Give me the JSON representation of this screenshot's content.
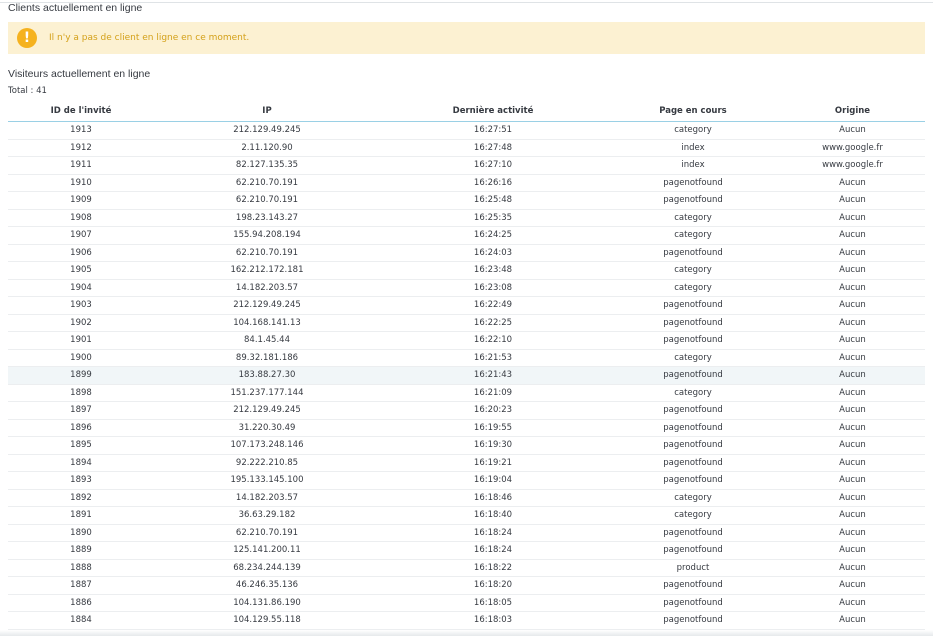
{
  "customers_section": {
    "title": "Clients actuellement en ligne",
    "alert_text": "Il n'y a pas de client en ligne en ce moment.",
    "alert_icon": "!"
  },
  "visitors_section": {
    "title": "Visiteurs actuellement en ligne",
    "total": "Total : 41",
    "columns": [
      "ID de l'invité",
      "IP",
      "Dernière activité",
      "Page en cours",
      "Origine"
    ],
    "highlighted_row_id": "1899",
    "rows": [
      [
        "1913",
        "212.129.49.245",
        "16:27:51",
        "category",
        "Aucun"
      ],
      [
        "1912",
        "2.11.120.90",
        "16:27:48",
        "index",
        "www.google.fr"
      ],
      [
        "1911",
        "82.127.135.35",
        "16:27:10",
        "index",
        "www.google.fr"
      ],
      [
        "1910",
        "62.210.70.191",
        "16:26:16",
        "pagenotfound",
        "Aucun"
      ],
      [
        "1909",
        "62.210.70.191",
        "16:25:48",
        "pagenotfound",
        "Aucun"
      ],
      [
        "1908",
        "198.23.143.27",
        "16:25:35",
        "category",
        "Aucun"
      ],
      [
        "1907",
        "155.94.208.194",
        "16:24:25",
        "category",
        "Aucun"
      ],
      [
        "1906",
        "62.210.70.191",
        "16:24:03",
        "pagenotfound",
        "Aucun"
      ],
      [
        "1905",
        "162.212.172.181",
        "16:23:48",
        "category",
        "Aucun"
      ],
      [
        "1904",
        "14.182.203.57",
        "16:23:08",
        "category",
        "Aucun"
      ],
      [
        "1903",
        "212.129.49.245",
        "16:22:49",
        "pagenotfound",
        "Aucun"
      ],
      [
        "1902",
        "104.168.141.13",
        "16:22:25",
        "pagenotfound",
        "Aucun"
      ],
      [
        "1901",
        "84.1.45.44",
        "16:22:10",
        "pagenotfound",
        "Aucun"
      ],
      [
        "1900",
        "89.32.181.186",
        "16:21:53",
        "category",
        "Aucun"
      ],
      [
        "1899",
        "183.88.27.30",
        "16:21:43",
        "pagenotfound",
        "Aucun"
      ],
      [
        "1898",
        "151.237.177.144",
        "16:21:09",
        "category",
        "Aucun"
      ],
      [
        "1897",
        "212.129.49.245",
        "16:20:23",
        "pagenotfound",
        "Aucun"
      ],
      [
        "1896",
        "31.220.30.49",
        "16:19:55",
        "pagenotfound",
        "Aucun"
      ],
      [
        "1895",
        "107.173.248.146",
        "16:19:30",
        "pagenotfound",
        "Aucun"
      ],
      [
        "1894",
        "92.222.210.85",
        "16:19:21",
        "pagenotfound",
        "Aucun"
      ],
      [
        "1893",
        "195.133.145.100",
        "16:19:04",
        "pagenotfound",
        "Aucun"
      ],
      [
        "1892",
        "14.182.203.57",
        "16:18:46",
        "category",
        "Aucun"
      ],
      [
        "1891",
        "36.63.29.182",
        "16:18:40",
        "category",
        "Aucun"
      ],
      [
        "1890",
        "62.210.70.191",
        "16:18:24",
        "pagenotfound",
        "Aucun"
      ],
      [
        "1889",
        "125.141.200.11",
        "16:18:24",
        "pagenotfound",
        "Aucun"
      ],
      [
        "1888",
        "68.234.244.139",
        "16:18:22",
        "product",
        "Aucun"
      ],
      [
        "1887",
        "46.246.35.136",
        "16:18:20",
        "pagenotfound",
        "Aucun"
      ],
      [
        "1886",
        "104.131.86.190",
        "16:18:05",
        "pagenotfound",
        "Aucun"
      ],
      [
        "1884",
        "104.129.55.118",
        "16:18:03",
        "pagenotfound",
        "Aucun"
      ]
    ]
  },
  "colors": {
    "alert_background": "#fcf1d2",
    "alert_icon": "#f5b21f",
    "alert_text": "#d4a11a",
    "header_border": "#9ad0e5",
    "highlight_row": "#f1f6f8"
  }
}
